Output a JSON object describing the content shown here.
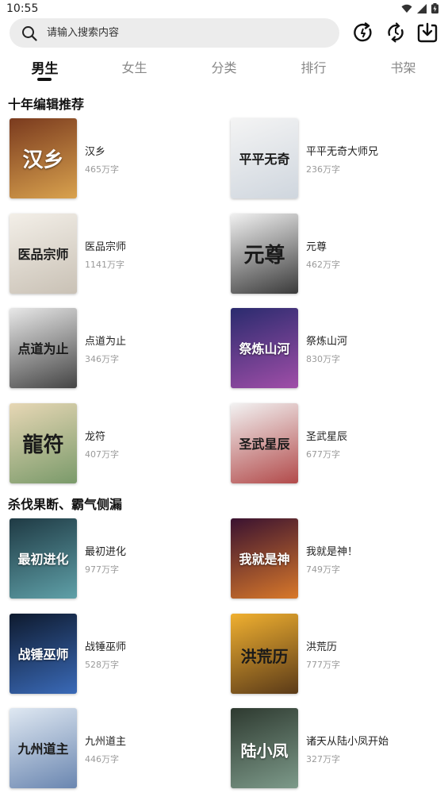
{
  "status_bar": {
    "time": "10:55"
  },
  "search": {
    "placeholder": "请输入搜索内容"
  },
  "tabs": [
    {
      "label": "男生"
    },
    {
      "label": "女生"
    },
    {
      "label": "分类"
    },
    {
      "label": "排行"
    },
    {
      "label": "书架"
    }
  ],
  "sections": [
    {
      "title": "十年编辑推荐",
      "books": [
        {
          "title": "汉乡",
          "words": "465万字",
          "cover_text": "汉乡",
          "cover_colors": [
            "#7a3a1e",
            "#d9a24e"
          ]
        },
        {
          "title": "平平无奇大师兄",
          "words": "236万字",
          "cover_text": "平平无奇",
          "cover_colors": [
            "#f4f4f4",
            "#cfd6de"
          ]
        },
        {
          "title": "医品宗师",
          "words": "1141万字",
          "cover_text": "医品宗师",
          "cover_colors": [
            "#f3efe8",
            "#c9c1b5"
          ]
        },
        {
          "title": "元尊",
          "words": "462万字",
          "cover_text": "元尊",
          "cover_colors": [
            "#f1f1f1",
            "#3a3a3a"
          ]
        },
        {
          "title": "点道为止",
          "words": "346万字",
          "cover_text": "点道为止",
          "cover_colors": [
            "#e8e8e8",
            "#444444"
          ]
        },
        {
          "title": "祭炼山河",
          "words": "830万字",
          "cover_text": "祭炼山河",
          "cover_colors": [
            "#2a2b6e",
            "#a04ea8"
          ]
        },
        {
          "title": "龙符",
          "words": "407万字",
          "cover_text": "龍符",
          "cover_colors": [
            "#e7d7b5",
            "#7a9a6a"
          ]
        },
        {
          "title": "圣武星辰",
          "words": "677万字",
          "cover_text": "圣武星辰",
          "cover_colors": [
            "#f2f2f2",
            "#b24a4a"
          ]
        }
      ]
    },
    {
      "title": "杀伐果断、霸气侧漏",
      "books": [
        {
          "title": "最初进化",
          "words": "977万字",
          "cover_text": "最初进化",
          "cover_colors": [
            "#1f3a44",
            "#5fa0a8"
          ]
        },
        {
          "title": "我就是神！",
          "words": "749万字",
          "cover_text": "我就是神",
          "cover_colors": [
            "#3a1230",
            "#d8782a"
          ]
        },
        {
          "title": "战锤巫师",
          "words": "528万字",
          "cover_text": "战锤巫师",
          "cover_colors": [
            "#0e1a2e",
            "#3a6ab8"
          ]
        },
        {
          "title": "洪荒历",
          "words": "777万字",
          "cover_text": "洪荒历",
          "cover_colors": [
            "#f0b030",
            "#5a3a18"
          ]
        },
        {
          "title": "九州道主",
          "words": "446万字",
          "cover_text": "九州道主",
          "cover_colors": [
            "#dfe8f2",
            "#6a86b0"
          ]
        },
        {
          "title": "诸天从陆小凤开始",
          "words": "327万字",
          "cover_text": "陆小凤",
          "cover_colors": [
            "#2e3a30",
            "#7d9a8a"
          ]
        }
      ]
    }
  ],
  "colors": {
    "active_tab": "#111111",
    "inactive_tab": "#888888",
    "search_bg": "#ececec",
    "meta_text": "#9a9a9a"
  }
}
